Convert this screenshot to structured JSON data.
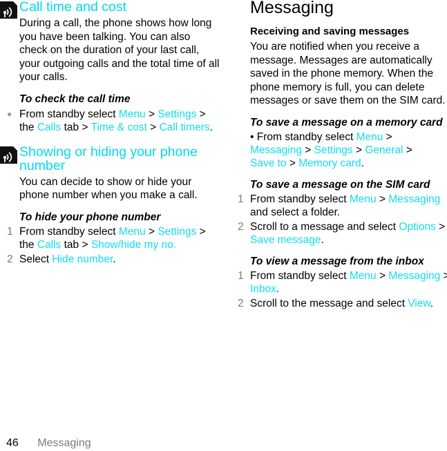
{
  "left_column": {
    "sections": [
      {
        "icon": "network-service-icon",
        "title": "Call time and cost",
        "body": "During a call, the phone shows how long you have been talking. You can also check on the duration of your last call, your outgoing calls and the total time of all your calls.",
        "task_title": "To check the call time",
        "bullet_step": {
          "parts": [
            {
              "text": "From standby select ",
              "link": false
            },
            {
              "text": "Menu",
              "link": true
            },
            {
              "text": " > ",
              "link": false
            },
            {
              "text": "Settings",
              "link": true
            },
            {
              "text": " > the ",
              "link": false
            },
            {
              "text": "Calls",
              "link": true
            },
            {
              "text": " tab > ",
              "link": false
            },
            {
              "text": "Time & cost",
              "link": true
            },
            {
              "text": " > ",
              "link": false
            },
            {
              "text": "Call timers",
              "link": true
            },
            {
              "text": ".",
              "link": false
            }
          ]
        }
      },
      {
        "icon": "network-service-icon",
        "title": "Showing or hiding your phone number",
        "body": "You can decide to show or hide your phone number when you make a call.",
        "task_title": "To hide your phone number",
        "steps": [
          {
            "num": "1",
            "parts": [
              {
                "text": "From standby select ",
                "link": false
              },
              {
                "text": "Menu",
                "link": true
              },
              {
                "text": " > ",
                "link": false
              },
              {
                "text": "Settings",
                "link": true
              },
              {
                "text": " > the ",
                "link": false
              },
              {
                "text": "Calls",
                "link": true
              },
              {
                "text": " tab > ",
                "link": false
              },
              {
                "text": "Show/hide my no.",
                "link": true
              }
            ]
          },
          {
            "num": "2",
            "parts": [
              {
                "text": "Select ",
                "link": false
              },
              {
                "text": "Hide number",
                "link": true
              },
              {
                "text": ".",
                "link": false
              }
            ]
          }
        ]
      }
    ]
  },
  "right_column": {
    "chapter_title": "Messaging",
    "subheading": "Receiving and saving messages",
    "body": "You are notified when you receive a message. Messages are automatically saved in the phone memory. When the phone memory is full, you can delete messages or save them on the SIM card.",
    "tasks": [
      {
        "title": "To save a message on a memory card",
        "bullet": "• ",
        "parts": [
          {
            "text": "From standby select ",
            "link": false
          },
          {
            "text": "Menu",
            "link": true
          },
          {
            "text": " > ",
            "link": false
          },
          {
            "text": "Messaging",
            "link": true
          },
          {
            "text": " > ",
            "link": false
          },
          {
            "text": "Settings",
            "link": true
          },
          {
            "text": " > ",
            "link": false
          },
          {
            "text": "General",
            "link": true
          },
          {
            "text": " > ",
            "link": false
          },
          {
            "text": "Save to",
            "link": true
          },
          {
            "text": " > ",
            "link": false
          },
          {
            "text": "Memory card",
            "link": true
          },
          {
            "text": ".",
            "link": false
          }
        ]
      },
      {
        "title": "To save a message on the SIM card",
        "steps": [
          {
            "num": "1",
            "parts": [
              {
                "text": "From standby select ",
                "link": false
              },
              {
                "text": "Menu",
                "link": true
              },
              {
                "text": " > ",
                "link": false
              },
              {
                "text": "Messaging",
                "link": true
              },
              {
                "text": " and select a folder.",
                "link": false
              }
            ]
          },
          {
            "num": "2",
            "parts": [
              {
                "text": "Scroll to a message and select ",
                "link": false
              },
              {
                "text": "Options",
                "link": true
              },
              {
                "text": " > ",
                "link": false
              },
              {
                "text": "Save message",
                "link": true
              },
              {
                "text": ".",
                "link": false
              }
            ]
          }
        ]
      },
      {
        "title": "To view a message from the inbox",
        "steps": [
          {
            "num": "1",
            "parts": [
              {
                "text": "From standby select ",
                "link": false
              },
              {
                "text": "Menu",
                "link": true
              },
              {
                "text": " > ",
                "link": false
              },
              {
                "text": "Messaging",
                "link": true
              },
              {
                "text": " > ",
                "link": false
              },
              {
                "text": "Inbox",
                "link": true
              },
              {
                "text": ".",
                "link": false
              }
            ]
          },
          {
            "num": "2",
            "parts": [
              {
                "text": "Scroll to the message and select ",
                "link": false
              },
              {
                "text": "View",
                "link": true
              },
              {
                "text": ".",
                "link": false
              }
            ]
          }
        ]
      }
    ]
  },
  "footer": {
    "page_number": "46",
    "section_title": "Messaging"
  },
  "colors": {
    "link": "#14dcef",
    "heading": "#00d9f0",
    "step_number": "#7a7a7a"
  }
}
